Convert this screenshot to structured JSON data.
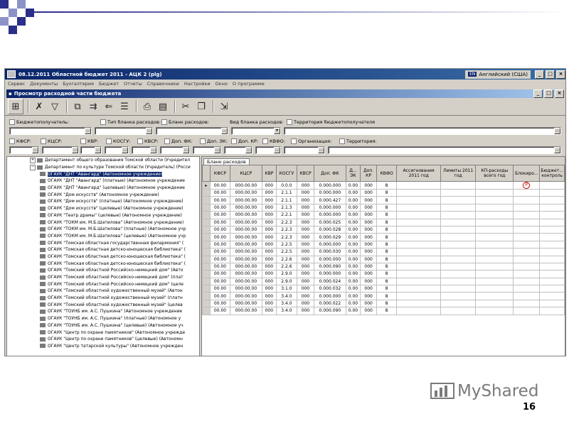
{
  "window": {
    "title": "08.12.2011 Областной бюджет 2011 - АЦК 2 (plg)",
    "lang_code": "EN",
    "lang_label": "Английский (США)"
  },
  "menu": [
    "Сервис",
    "Документы",
    "Бухгалтерия",
    "Бюджет",
    "Отчеты",
    "Справочники",
    "Настройки",
    "Окно",
    "О программе"
  ],
  "child_window": {
    "title": "Просмотр расходной части бюджета"
  },
  "filters": {
    "recipient": "Бюджетополучатель:",
    "blank_type": "Тип бланка расходов:",
    "blank": "Бланк расходов:",
    "blank_kind": "Вид бланка расходов:",
    "territory_recipient": "Территория бюджетополучателя",
    "kfsr": "КФСР:",
    "kcsr": "КЦСР:",
    "kvr": "КВР:",
    "kosgu": "КОСГУ:",
    "kvsr": "КВСР:",
    "fk": "Доп. ФК:",
    "ek": "Доп. ЭК:",
    "kr": "Доп. КР:",
    "kvfo": "КВФО:",
    "org": "Организация:",
    "territory": "Территория:",
    "dots": "..."
  },
  "tree": [
    {
      "label": "Департамент общего образования Томской области (Учредител",
      "type": "dept"
    },
    {
      "label": "Департамент по культуре Томской области (Учредитель) (Росси",
      "type": "dept"
    },
    {
      "label": "ОГАУК \"ДНТ \"Авангард\" (Автономное учреждение)",
      "type": "item",
      "selected": true
    },
    {
      "label": "ОГАУК \"ДНТ \"Авангард\" (платные) (Автономное учреждение",
      "type": "item"
    },
    {
      "label": "ОГАУК \"ДНТ \"Авангард\" (целевые) (Автономное учреждение",
      "type": "item"
    },
    {
      "label": "ОГАУК \"Дом искусств\" (Автономное учреждение)",
      "type": "item"
    },
    {
      "label": "ОГАУК \"Дом искусств\" (платные) (Автономное учреждение)",
      "type": "item"
    },
    {
      "label": "ОГАУК \"Дом искусств\" (целевые) (Автономное учреждение)",
      "type": "item"
    },
    {
      "label": "ОГАУК \"Театр драмы\" (целевые) (Автономное учреждение)",
      "type": "item"
    },
    {
      "label": "ОГАУК \"ТОКМ им. М.Б.Шатилова\" (Автономное учреждение)",
      "type": "item"
    },
    {
      "label": "ОГАУК \"ТОКМ им. М.Б.Шатилова\" (платные) (Автономное учр",
      "type": "item"
    },
    {
      "label": "ОГАУК \"ТОКМ им. М.Б.Шатилова\" (целевые) (Автономное учр",
      "type": "item"
    },
    {
      "label": "ОГАУК \"Томская областная государственная филармония\" (",
      "type": "item"
    },
    {
      "label": "ОГАУК \"Томская областная детско-юношеская библиотека\" (",
      "type": "item"
    },
    {
      "label": "ОГАУК \"Томская областная детско-юношеская библиотека\" (",
      "type": "item"
    },
    {
      "label": "ОГАУК \"Томская областная детско-юношеская библиотека\" (",
      "type": "item"
    },
    {
      "label": "ОГАУК \"Томский областной Российско-немецкий дом\" (Авто",
      "type": "item"
    },
    {
      "label": "ОГАУК \"Томский областной Российско-немецкий дом\" (плат",
      "type": "item"
    },
    {
      "label": "ОГАУК \"Томский областной Российско-немецкий дом\" (целе",
      "type": "item"
    },
    {
      "label": "ОГАУК \"Томский областной художественный музей\" (Автон",
      "type": "item"
    },
    {
      "label": "ОГАУК \"Томский областной художественный музей\" (платн",
      "type": "item"
    },
    {
      "label": "ОГАУК \"Томский областной художественный музей\" (целев",
      "type": "item"
    },
    {
      "label": "ОГАУК \"ТОУНБ им. А.С. Пушкина\" (Автономное учреждение",
      "type": "item"
    },
    {
      "label": "ОГАУК \"ТОУНБ им. А.С. Пушкина\" (платные) (Автономное у",
      "type": "item"
    },
    {
      "label": "ОГАУК \"ТОУНБ им. А.С. Пушкина\" (целевые) (Автономное уч",
      "type": "item"
    },
    {
      "label": "ОГАУК \"Центр по охране памятников\" (Автономное учрежде",
      "type": "item"
    },
    {
      "label": "ОГАУК \"Центр по охране памятников\" (целевые) (Автономн",
      "type": "item"
    },
    {
      "label": "ОГАУК \"Центр татарской культуры\" (Автономное учрежден",
      "type": "item"
    }
  ],
  "grid": {
    "tab": "Бланк расходов",
    "columns": [
      "КФСР",
      "КЦСР",
      "КВР",
      "КОСГУ",
      "КВСР",
      "Доп. ФК",
      "Д... ЭК",
      "Доп. КР",
      "КВФО",
      "Ассигнования 2011 год",
      "Лимиты 2011 год",
      "КП-расходы всего год",
      "Блокиро...",
      "Бюджет... контроль"
    ],
    "rows": [
      [
        "00.00",
        "000.00.00",
        "000",
        "0.0.0",
        "000",
        "0.000.000",
        "0.00",
        "000",
        "8"
      ],
      [
        "00.00",
        "000.00.00",
        "000",
        "2.1.1",
        "000",
        "0.000.000",
        "0.00",
        "000",
        "8"
      ],
      [
        "00.00",
        "000.00.00",
        "000",
        "2.1.1",
        "000",
        "0.000.427",
        "0.00",
        "000",
        "8"
      ],
      [
        "00.00",
        "000.00.00",
        "000",
        "2.1.3",
        "000",
        "0.000.000",
        "0.00",
        "000",
        "8"
      ],
      [
        "00.00",
        "000.00.00",
        "000",
        "2.2.1",
        "000",
        "0.000.000",
        "0.00",
        "000",
        "8"
      ],
      [
        "00.00",
        "000.00.00",
        "000",
        "2.2.3",
        "000",
        "0.000.025",
        "0.00",
        "000",
        "8"
      ],
      [
        "00.00",
        "000.00.00",
        "000",
        "2.2.3",
        "000",
        "0.000.028",
        "0.00",
        "000",
        "8"
      ],
      [
        "00.00",
        "000.00.00",
        "000",
        "2.2.3",
        "000",
        "0.000.029",
        "0.00",
        "000",
        "8"
      ],
      [
        "00.00",
        "000.00.00",
        "000",
        "2.2.5",
        "000",
        "0.000.000",
        "0.00",
        "000",
        "8"
      ],
      [
        "00.00",
        "000.00.00",
        "000",
        "2.2.5",
        "000",
        "0.000.030",
        "0.00",
        "000",
        "8"
      ],
      [
        "00.00",
        "000.00.00",
        "000",
        "2.2.6",
        "000",
        "0.000.000",
        "0.00",
        "000",
        "8"
      ],
      [
        "00.00",
        "000.00.00",
        "000",
        "2.2.6",
        "000",
        "0.000.090",
        "0.00",
        "000",
        "8"
      ],
      [
        "00.00",
        "000.00.00",
        "000",
        "2.9.0",
        "000",
        "0.000.000",
        "0.00",
        "000",
        "8"
      ],
      [
        "00.00",
        "000.00.00",
        "000",
        "2.9.0",
        "000",
        "0.000.024",
        "0.00",
        "000",
        "8"
      ],
      [
        "00.00",
        "000.00.00",
        "000",
        "3.1.0",
        "000",
        "0.000.032",
        "0.00",
        "000",
        "8"
      ],
      [
        "00.00",
        "000.00.00",
        "000",
        "3.4.0",
        "000",
        "0.000.000",
        "0.00",
        "000",
        "8"
      ],
      [
        "00.00",
        "000.00.00",
        "000",
        "3.4.0",
        "000",
        "0.000.022",
        "0.00",
        "000",
        "8"
      ],
      [
        "00.00",
        "000.00.00",
        "000",
        "3.4.0",
        "000",
        "0.000.090",
        "0.00",
        "000",
        "8"
      ]
    ],
    "block_marker": "P"
  },
  "logo": {
    "text": "MyShared"
  },
  "page_number": "16",
  "colors": {
    "accent_dark": "#2a2f8a",
    "accent_light": "#8c93c9",
    "logo_gray": "#7a7a7a"
  }
}
